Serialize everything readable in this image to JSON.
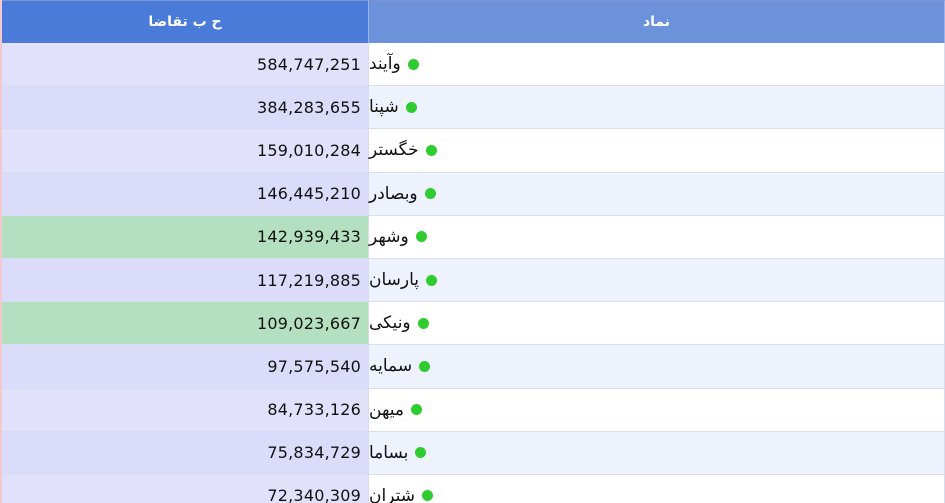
{
  "table": {
    "headers": {
      "demand": "ح ب تقاضا",
      "symbol": "نماد"
    },
    "status_color": "#2ecc2e",
    "rows": [
      {
        "symbol": "وآیند",
        "value": "584,747,251",
        "bg": "#e1e1fb",
        "symbg": "#ffffff"
      },
      {
        "symbol": "شپنا",
        "value": "384,283,655",
        "bg": "#dadcfa",
        "symbg": "#edf2fd"
      },
      {
        "symbol": "خگستر",
        "value": "159,010,284",
        "bg": "#e1e1fb",
        "symbg": "#ffffff"
      },
      {
        "symbol": "وبصادر",
        "value": "146,445,210",
        "bg": "#dadcfa",
        "symbg": "#edf2fd"
      },
      {
        "symbol": "وشهر",
        "value": "142,939,433",
        "bg": "#b4e0c0",
        "symbg": "#ffffff"
      },
      {
        "symbol": "پارسان",
        "value": "117,219,885",
        "bg": "#dadcfa",
        "symbg": "#edf2fd"
      },
      {
        "symbol": "ونیکی",
        "value": "109,023,667",
        "bg": "#b4e0c0",
        "symbg": "#ffffff"
      },
      {
        "symbol": "سمایه",
        "value": "97,575,540",
        "bg": "#dadcfa",
        "symbg": "#edf2fd"
      },
      {
        "symbol": "میهن",
        "value": "84,733,126",
        "bg": "#e1e1fb",
        "symbg": "#ffffff"
      },
      {
        "symbol": "بساما",
        "value": "75,834,729",
        "bg": "#dadcfa",
        "symbg": "#edf2fd"
      },
      {
        "symbol": "شتران",
        "value": "72,340,309",
        "bg": "#e1e1fb",
        "symbg": "#ffffff"
      }
    ]
  }
}
